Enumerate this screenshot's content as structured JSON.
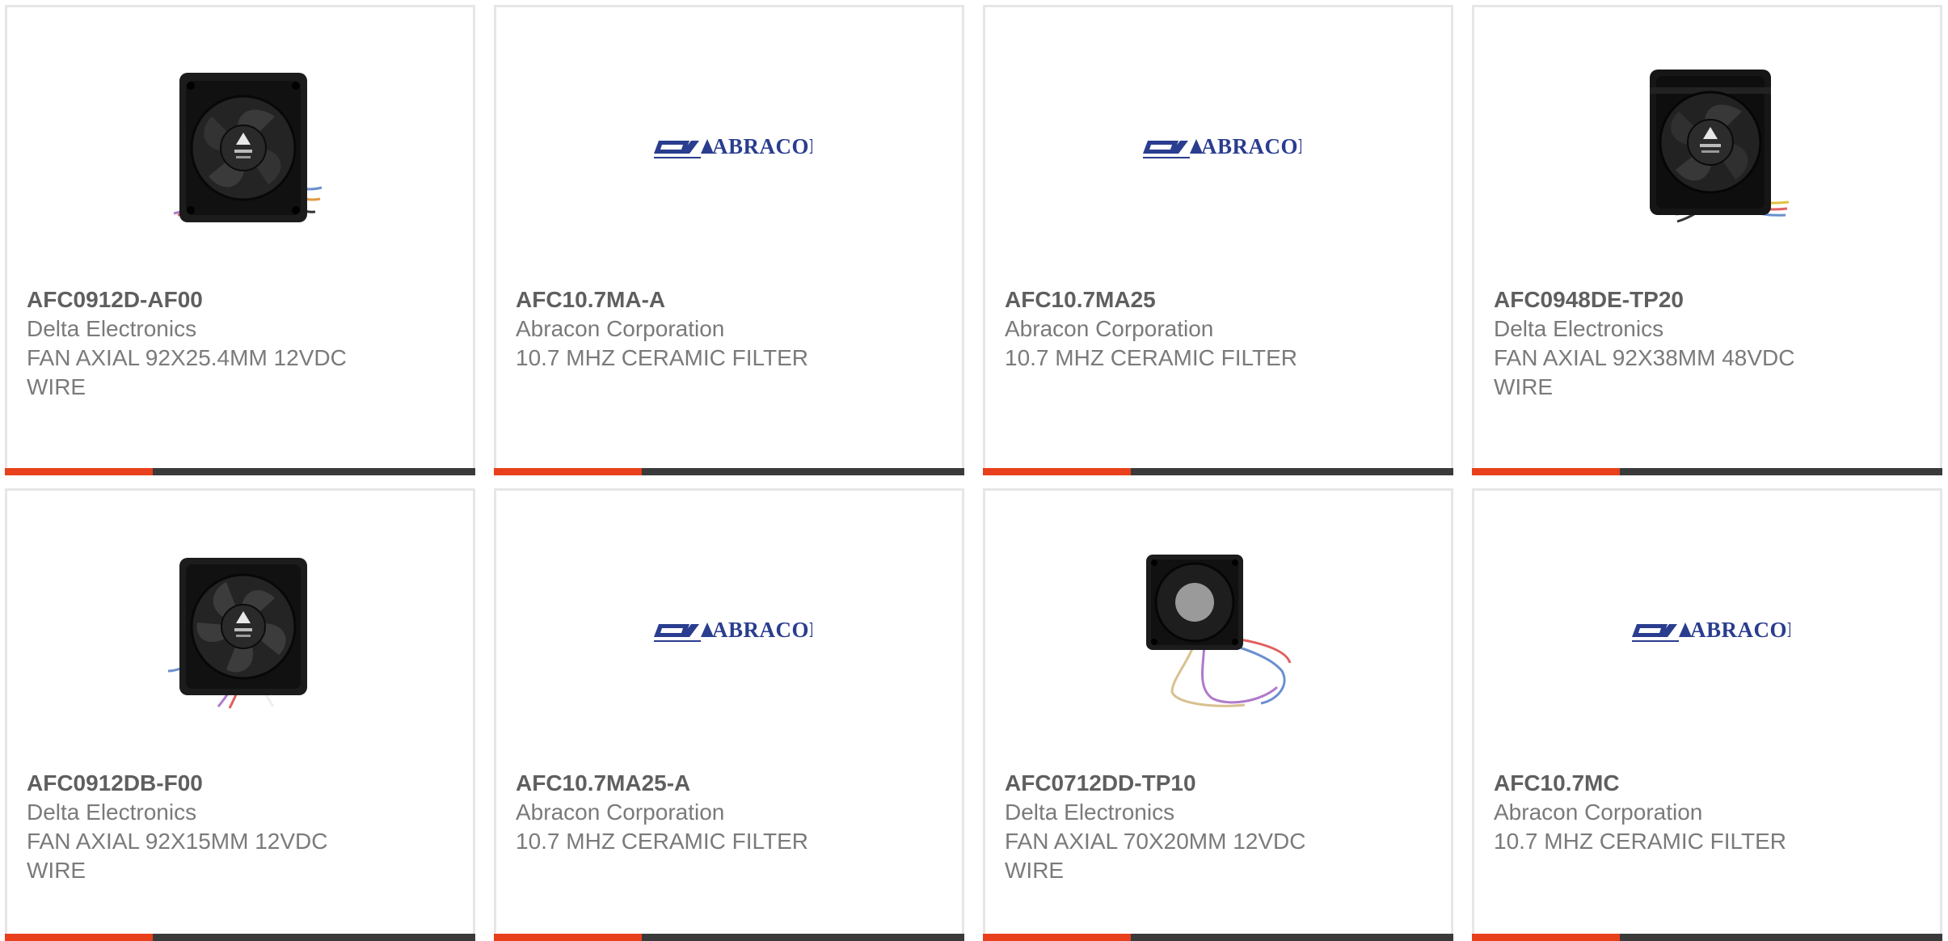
{
  "colors": {
    "accent": "#e8401c",
    "bar": "#3a3a3a",
    "card_border": "#e6e6e6",
    "abracon_blue": "#2a3d8f"
  },
  "abracon_logo_text": "ABRACON",
  "products": [
    {
      "part_number": "AFC0912D-AF00",
      "manufacturer": "Delta Electronics",
      "desc_line1": "FAN AXIAL 92X25.4MM 12VDC",
      "desc_line2": "WIRE",
      "image": "fan-icon"
    },
    {
      "part_number": "AFC10.7MA-A",
      "manufacturer": "Abracon Corporation",
      "desc_line1": "10.7 MHZ CERAMIC FILTER",
      "desc_line2": "",
      "image": "abracon-logo"
    },
    {
      "part_number": "AFC10.7MA25",
      "manufacturer": "Abracon Corporation",
      "desc_line1": "10.7 MHZ CERAMIC FILTER",
      "desc_line2": "",
      "image": "abracon-logo"
    },
    {
      "part_number": "AFC0948DE-TP20",
      "manufacturer": "Delta Electronics",
      "desc_line1": "FAN AXIAL 92X38MM 48VDC",
      "desc_line2": "WIRE",
      "image": "fan-icon"
    },
    {
      "part_number": "AFC0912DB-F00",
      "manufacturer": "Delta Electronics",
      "desc_line1": "FAN AXIAL 92X15MM 12VDC",
      "desc_line2": "WIRE",
      "image": "fan-icon"
    },
    {
      "part_number": "AFC10.7MA25-A",
      "manufacturer": "Abracon Corporation",
      "desc_line1": "10.7 MHZ CERAMIC FILTER",
      "desc_line2": "",
      "image": "abracon-logo"
    },
    {
      "part_number": "AFC0712DD-TP10",
      "manufacturer": "Delta Electronics",
      "desc_line1": "FAN AXIAL 70X20MM 12VDC",
      "desc_line2": "WIRE",
      "image": "fan-icon"
    },
    {
      "part_number": "AFC10.7MC",
      "manufacturer": "Abracon Corporation",
      "desc_line1": "10.7 MHZ CERAMIC FILTER",
      "desc_line2": "",
      "image": "abracon-logo"
    }
  ]
}
